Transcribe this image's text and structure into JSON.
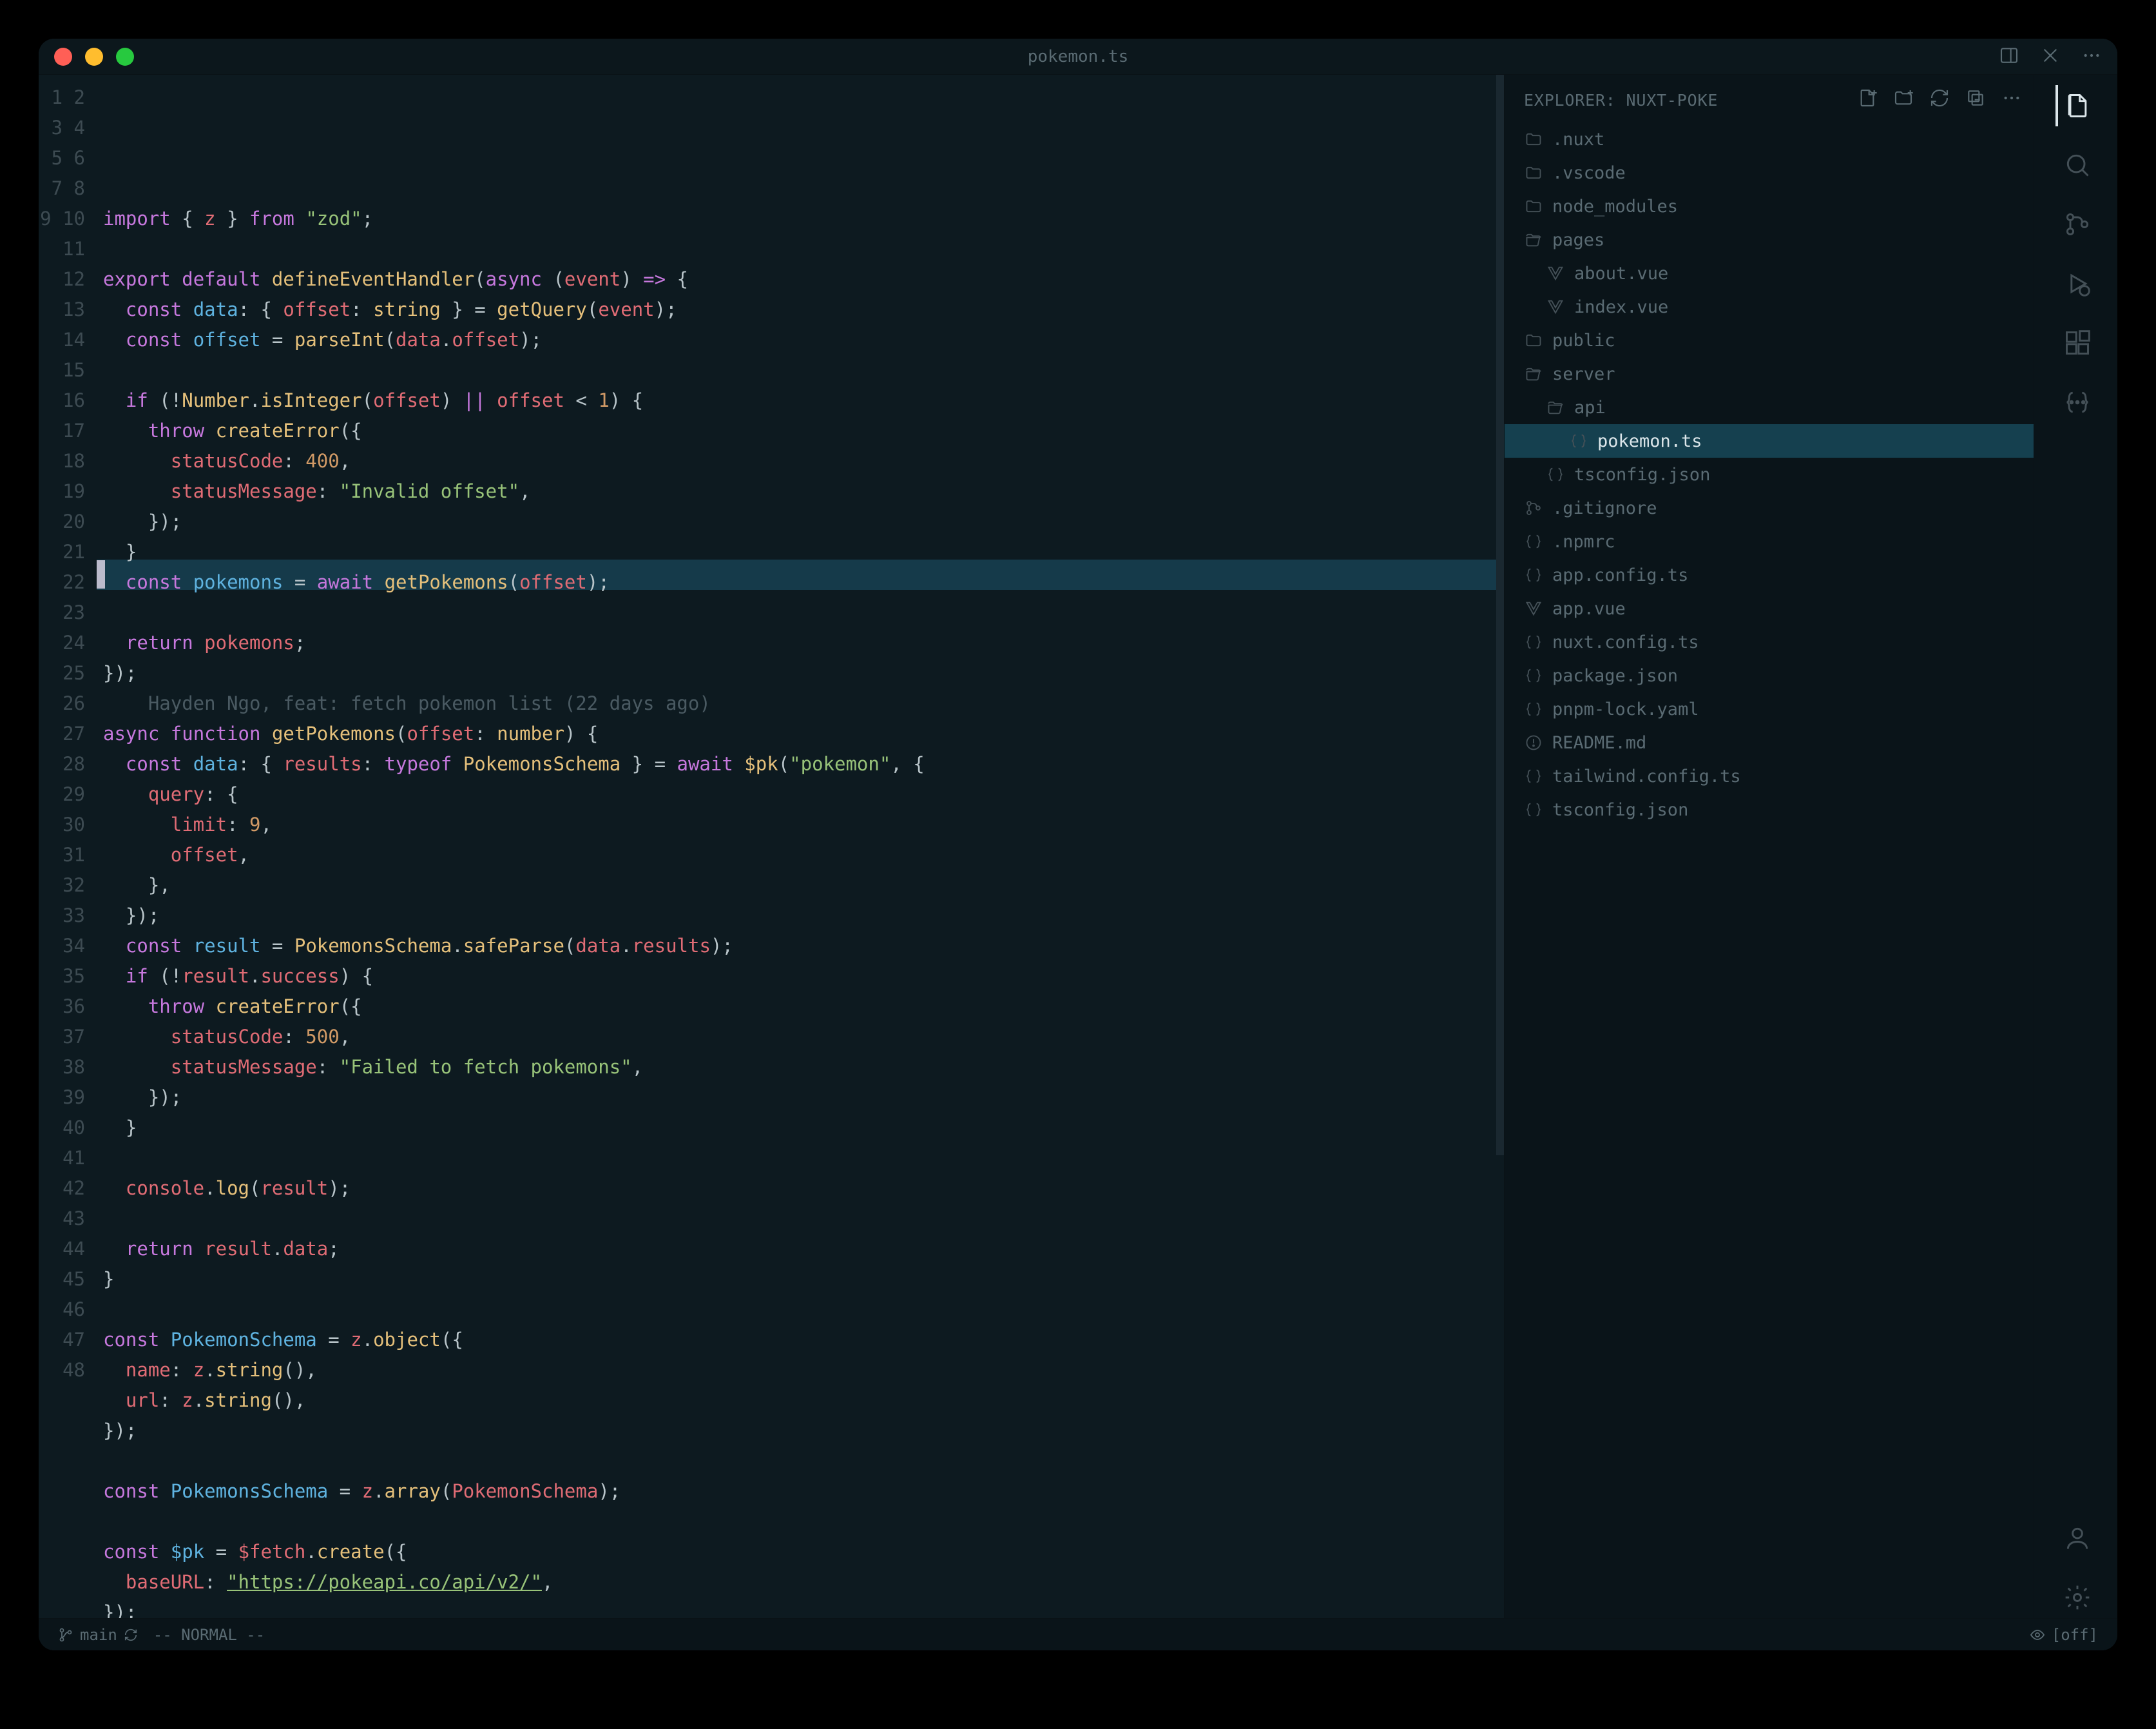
{
  "titlebar": {
    "filename": "pokemon.ts"
  },
  "explorer": {
    "header": "EXPLORER: NUXT-POKE",
    "items": [
      {
        "depth": 0,
        "type": "folder",
        "label": ".nuxt"
      },
      {
        "depth": 0,
        "type": "folder",
        "label": ".vscode"
      },
      {
        "depth": 0,
        "type": "folder",
        "label": "node_modules"
      },
      {
        "depth": 0,
        "type": "folder-open",
        "label": "pages"
      },
      {
        "depth": 1,
        "type": "file",
        "icon": "vue",
        "label": "about.vue"
      },
      {
        "depth": 1,
        "type": "file",
        "icon": "vue",
        "label": "index.vue"
      },
      {
        "depth": 0,
        "type": "folder",
        "label": "public"
      },
      {
        "depth": 0,
        "type": "folder-open",
        "label": "server"
      },
      {
        "depth": 1,
        "type": "folder-open",
        "label": "api"
      },
      {
        "depth": 2,
        "type": "file",
        "icon": "ts",
        "label": "pokemon.ts",
        "selected": true
      },
      {
        "depth": 1,
        "type": "file",
        "icon": "json",
        "label": "tsconfig.json"
      },
      {
        "depth": 0,
        "type": "file",
        "icon": "git",
        "label": ".gitignore"
      },
      {
        "depth": 0,
        "type": "file",
        "icon": "npm",
        "label": ".npmrc"
      },
      {
        "depth": 0,
        "type": "file",
        "icon": "ts",
        "label": "app.config.ts"
      },
      {
        "depth": 0,
        "type": "file",
        "icon": "vue",
        "label": "app.vue"
      },
      {
        "depth": 0,
        "type": "file",
        "icon": "ts",
        "label": "nuxt.config.ts"
      },
      {
        "depth": 0,
        "type": "file",
        "icon": "json",
        "label": "package.json"
      },
      {
        "depth": 0,
        "type": "file",
        "icon": "yaml",
        "label": "pnpm-lock.yaml"
      },
      {
        "depth": 0,
        "type": "file",
        "icon": "md",
        "label": "README.md"
      },
      {
        "depth": 0,
        "type": "file",
        "icon": "ts",
        "label": "tailwind.config.ts"
      },
      {
        "depth": 0,
        "type": "file",
        "icon": "json",
        "label": "tsconfig.json"
      }
    ]
  },
  "editor": {
    "blame_line": 17,
    "blame_text": "    Hayden Ngo, feat: fetch pokemon list (22 days ago)",
    "lines": [
      [
        [
          "kw",
          "import"
        ],
        [
          "op",
          " { "
        ],
        [
          "var",
          "z"
        ],
        [
          "op",
          " } "
        ],
        [
          "kw",
          "from"
        ],
        [
          "op",
          " "
        ],
        [
          "str",
          "\"zod\""
        ],
        [
          "op",
          ";"
        ]
      ],
      [],
      [
        [
          "kw",
          "export"
        ],
        [
          "op",
          " "
        ],
        [
          "kw",
          "default"
        ],
        [
          "op",
          " "
        ],
        [
          "fnY",
          "defineEventHandler"
        ],
        [
          "op",
          "("
        ],
        [
          "kw",
          "async"
        ],
        [
          "op",
          " ("
        ],
        [
          "var",
          "event"
        ],
        [
          "op",
          ") "
        ],
        [
          "ctrl",
          "=>"
        ],
        [
          "op",
          " {"
        ]
      ],
      [
        [
          "op",
          "  "
        ],
        [
          "kw",
          "const"
        ],
        [
          "op",
          " "
        ],
        [
          "def",
          "data"
        ],
        [
          "op",
          ": { "
        ],
        [
          "prop",
          "offset"
        ],
        [
          "op",
          ": "
        ],
        [
          "type",
          "string"
        ],
        [
          "op",
          " } = "
        ],
        [
          "fnY",
          "getQuery"
        ],
        [
          "op",
          "("
        ],
        [
          "var",
          "event"
        ],
        [
          "op",
          ");"
        ]
      ],
      [
        [
          "op",
          "  "
        ],
        [
          "kw",
          "const"
        ],
        [
          "op",
          " "
        ],
        [
          "def",
          "offset"
        ],
        [
          "op",
          " = "
        ],
        [
          "fnY",
          "parseInt"
        ],
        [
          "op",
          "("
        ],
        [
          "var",
          "data"
        ],
        [
          "op",
          "."
        ],
        [
          "var",
          "offset"
        ],
        [
          "op",
          ");"
        ]
      ],
      [],
      [
        [
          "op",
          "  "
        ],
        [
          "ctrl",
          "if"
        ],
        [
          "op",
          " (!"
        ],
        [
          "type",
          "Number"
        ],
        [
          "op",
          "."
        ],
        [
          "fnY",
          "isInteger"
        ],
        [
          "op",
          "("
        ],
        [
          "var",
          "offset"
        ],
        [
          "op",
          ") "
        ],
        [
          "ctrl",
          "||"
        ],
        [
          "op",
          " "
        ],
        [
          "var",
          "offset"
        ],
        [
          "op",
          " < "
        ],
        [
          "num",
          "1"
        ],
        [
          "op",
          ") {"
        ]
      ],
      [
        [
          "op",
          "    "
        ],
        [
          "ctrl",
          "throw"
        ],
        [
          "op",
          " "
        ],
        [
          "fnY",
          "createError"
        ],
        [
          "op",
          "({"
        ]
      ],
      [
        [
          "op",
          "      "
        ],
        [
          "prop",
          "statusCode"
        ],
        [
          "op",
          ": "
        ],
        [
          "num",
          "400"
        ],
        [
          "op",
          ","
        ]
      ],
      [
        [
          "op",
          "      "
        ],
        [
          "prop",
          "statusMessage"
        ],
        [
          "op",
          ": "
        ],
        [
          "str",
          "\"Invalid offset\""
        ],
        [
          "op",
          ","
        ]
      ],
      [
        [
          "op",
          "    });"
        ]
      ],
      [
        [
          "op",
          "  }"
        ]
      ],
      [
        [
          "op",
          "  "
        ],
        [
          "kw",
          "const"
        ],
        [
          "op",
          " "
        ],
        [
          "def",
          "pokemons"
        ],
        [
          "op",
          " = "
        ],
        [
          "ctrl",
          "await"
        ],
        [
          "op",
          " "
        ],
        [
          "fnY",
          "getPokemons"
        ],
        [
          "op",
          "("
        ],
        [
          "var",
          "offset"
        ],
        [
          "op",
          ");"
        ]
      ],
      [],
      [
        [
          "op",
          "  "
        ],
        [
          "ctrl",
          "return"
        ],
        [
          "op",
          " "
        ],
        [
          "var",
          "pokemons"
        ],
        [
          "op",
          ";"
        ]
      ],
      [
        [
          "op",
          "});"
        ]
      ],
      [
        [
          "cmt",
          "    Hayden Ngo, feat: fetch pokemon list (22 days ago)"
        ]
      ],
      [
        [
          "kw",
          "async"
        ],
        [
          "op",
          " "
        ],
        [
          "kw",
          "function"
        ],
        [
          "op",
          " "
        ],
        [
          "fnY",
          "getPokemons"
        ],
        [
          "op",
          "("
        ],
        [
          "var",
          "offset"
        ],
        [
          "op",
          ": "
        ],
        [
          "type",
          "number"
        ],
        [
          "op",
          ") {"
        ]
      ],
      [
        [
          "op",
          "  "
        ],
        [
          "kw",
          "const"
        ],
        [
          "op",
          " "
        ],
        [
          "def",
          "data"
        ],
        [
          "op",
          ": { "
        ],
        [
          "prop",
          "results"
        ],
        [
          "op",
          ": "
        ],
        [
          "kw",
          "typeof"
        ],
        [
          "op",
          " "
        ],
        [
          "type",
          "PokemonsSchema"
        ],
        [
          "op",
          " } = "
        ],
        [
          "ctrl",
          "await"
        ],
        [
          "op",
          " "
        ],
        [
          "fnY",
          "$pk"
        ],
        [
          "op",
          "("
        ],
        [
          "str",
          "\"pokemon\""
        ],
        [
          "op",
          ", {"
        ]
      ],
      [
        [
          "op",
          "    "
        ],
        [
          "prop",
          "query"
        ],
        [
          "op",
          ": {"
        ]
      ],
      [
        [
          "op",
          "      "
        ],
        [
          "prop",
          "limit"
        ],
        [
          "op",
          ": "
        ],
        [
          "num",
          "9"
        ],
        [
          "op",
          ","
        ]
      ],
      [
        [
          "op",
          "      "
        ],
        [
          "var",
          "offset"
        ],
        [
          "op",
          ","
        ]
      ],
      [
        [
          "op",
          "    },"
        ]
      ],
      [
        [
          "op",
          "  });"
        ]
      ],
      [
        [
          "op",
          "  "
        ],
        [
          "kw",
          "const"
        ],
        [
          "op",
          " "
        ],
        [
          "def",
          "result"
        ],
        [
          "op",
          " = "
        ],
        [
          "type",
          "PokemonsSchema"
        ],
        [
          "op",
          "."
        ],
        [
          "fnY",
          "safeParse"
        ],
        [
          "op",
          "("
        ],
        [
          "var",
          "data"
        ],
        [
          "op",
          "."
        ],
        [
          "var",
          "results"
        ],
        [
          "op",
          ");"
        ]
      ],
      [
        [
          "op",
          "  "
        ],
        [
          "ctrl",
          "if"
        ],
        [
          "op",
          " (!"
        ],
        [
          "var",
          "result"
        ],
        [
          "op",
          "."
        ],
        [
          "var",
          "success"
        ],
        [
          "op",
          ") {"
        ]
      ],
      [
        [
          "op",
          "    "
        ],
        [
          "ctrl",
          "throw"
        ],
        [
          "op",
          " "
        ],
        [
          "fnY",
          "createError"
        ],
        [
          "op",
          "({"
        ]
      ],
      [
        [
          "op",
          "      "
        ],
        [
          "prop",
          "statusCode"
        ],
        [
          "op",
          ": "
        ],
        [
          "num",
          "500"
        ],
        [
          "op",
          ","
        ]
      ],
      [
        [
          "op",
          "      "
        ],
        [
          "prop",
          "statusMessage"
        ],
        [
          "op",
          ": "
        ],
        [
          "str",
          "\"Failed to fetch pokemons\""
        ],
        [
          "op",
          ","
        ]
      ],
      [
        [
          "op",
          "    });"
        ]
      ],
      [
        [
          "op",
          "  }"
        ]
      ],
      [],
      [
        [
          "op",
          "  "
        ],
        [
          "var",
          "console"
        ],
        [
          "op",
          "."
        ],
        [
          "fnY",
          "log"
        ],
        [
          "op",
          "("
        ],
        [
          "var",
          "result"
        ],
        [
          "op",
          ");"
        ]
      ],
      [],
      [
        [
          "op",
          "  "
        ],
        [
          "ctrl",
          "return"
        ],
        [
          "op",
          " "
        ],
        [
          "var",
          "result"
        ],
        [
          "op",
          "."
        ],
        [
          "var",
          "data"
        ],
        [
          "op",
          ";"
        ]
      ],
      [
        [
          "op",
          "}"
        ]
      ],
      [],
      [
        [
          "kw",
          "const"
        ],
        [
          "op",
          " "
        ],
        [
          "def",
          "PokemonSchema"
        ],
        [
          "op",
          " = "
        ],
        [
          "var",
          "z"
        ],
        [
          "op",
          "."
        ],
        [
          "fnY",
          "object"
        ],
        [
          "op",
          "({"
        ]
      ],
      [
        [
          "op",
          "  "
        ],
        [
          "prop",
          "name"
        ],
        [
          "op",
          ": "
        ],
        [
          "var",
          "z"
        ],
        [
          "op",
          "."
        ],
        [
          "fnY",
          "string"
        ],
        [
          "op",
          "(),"
        ]
      ],
      [
        [
          "op",
          "  "
        ],
        [
          "prop",
          "url"
        ],
        [
          "op",
          ": "
        ],
        [
          "var",
          "z"
        ],
        [
          "op",
          "."
        ],
        [
          "fnY",
          "string"
        ],
        [
          "op",
          "(),"
        ]
      ],
      [
        [
          "op",
          "});"
        ]
      ],
      [],
      [
        [
          "kw",
          "const"
        ],
        [
          "op",
          " "
        ],
        [
          "def",
          "PokemonsSchema"
        ],
        [
          "op",
          " = "
        ],
        [
          "var",
          "z"
        ],
        [
          "op",
          "."
        ],
        [
          "fnY",
          "array"
        ],
        [
          "op",
          "("
        ],
        [
          "var",
          "PokemonSchema"
        ],
        [
          "op",
          ");"
        ]
      ],
      [],
      [
        [
          "kw",
          "const"
        ],
        [
          "op",
          " "
        ],
        [
          "def",
          "$pk"
        ],
        [
          "op",
          " = "
        ],
        [
          "var",
          "$fetch"
        ],
        [
          "op",
          "."
        ],
        [
          "fnY",
          "create"
        ],
        [
          "op",
          "({"
        ]
      ],
      [
        [
          "op",
          "  "
        ],
        [
          "prop",
          "baseURL"
        ],
        [
          "op",
          ": "
        ],
        [
          "url",
          "\"https://pokeapi.co/api/v2/\""
        ],
        [
          "op",
          ","
        ]
      ],
      [
        [
          "op",
          "});"
        ]
      ],
      []
    ]
  },
  "statusbar": {
    "branch": "main",
    "vim_mode": "-- NORMAL --",
    "right": "[off]"
  }
}
